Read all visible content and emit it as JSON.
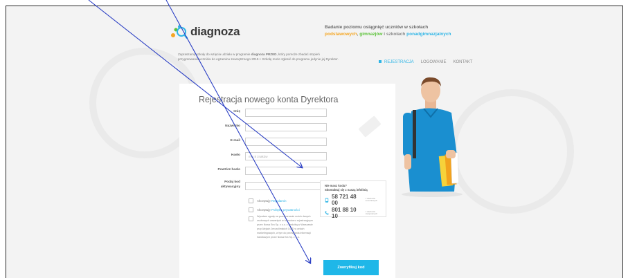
{
  "logo": {
    "text": "diagnoza"
  },
  "tagline": {
    "line1": "Badanie poziomu osiągnięć uczniów w szkołach",
    "part1": "podstawowych",
    "sep1": ",",
    "part2": "gimnazjów",
    "sep2": "i szkołach",
    "part3": "ponadgimnazjalnych"
  },
  "intro": {
    "prefix": "Zapraszamy szkoły do wzięcia udziału w programie",
    "brand": "diagnoza PRZED",
    "rest": ", który pomoże zbadać stopień przygotowania uczniów do egzaminu zewnętrznego 2015 r. Szkołę może zgłosić do programu jedynie jej Dyrektor."
  },
  "nav": {
    "items": [
      {
        "label": "REJESTRACJA",
        "active": true
      },
      {
        "label": "LOGOWANIE",
        "active": false
      },
      {
        "label": "KONTAKT",
        "active": false
      }
    ]
  },
  "form": {
    "title": "Rejestracja nowego konta Dyrektora",
    "fields": [
      {
        "label": "Imię",
        "value": "",
        "placeholder": ""
      },
      {
        "label": "Nazwisko",
        "value": "",
        "placeholder": ""
      },
      {
        "label": "E-mail",
        "value": "",
        "placeholder": ""
      },
      {
        "label": "Hasło",
        "value": "",
        "placeholder": "min 8 znaków"
      },
      {
        "label": "Powtórz hasło",
        "value": "",
        "placeholder": ""
      },
      {
        "label_line1": "Podaj kod",
        "label_line2": "aktywacyjny",
        "value": "",
        "placeholder": ""
      }
    ],
    "accept_terms": {
      "prefix": "Akceptuję",
      "link": "Regulamin"
    },
    "accept_privacy": {
      "prefix": "Akceptuję",
      "link": "Politykę prywatności"
    },
    "consent_text": "Wyrażam zgodę na przetwarzanie moich danych osobowych zawartych w formularzu rejestracyjnym przez Nowa Era Sp. z o.o. z siedzibą w Warszawie przy Alejach Jerozolimskich 146D w celach marketingowych, w tym do przesyłania informacji handlowych przez Nowa Era Sp. z o.o.",
    "verify_button": "Zweryfikuj kod"
  },
  "help_box": {
    "title_line1": "Nie masz kodu?",
    "title_line2": "Skontaktuj się z naszą infolinią",
    "phones": [
      {
        "number": "58 721 48 00",
        "note": "z telefonów komórkowych",
        "icon": "phone-icon"
      },
      {
        "number": "801 88 10 10",
        "note": "z telefonów stacjonarnych",
        "icon": "handset-icon"
      }
    ]
  },
  "colors": {
    "accent": "#1fb7e8",
    "orange": "#f5a623",
    "green": "#5cc23a",
    "blue": "#2fb5e6",
    "annotation_line": "#2b3fc4"
  }
}
